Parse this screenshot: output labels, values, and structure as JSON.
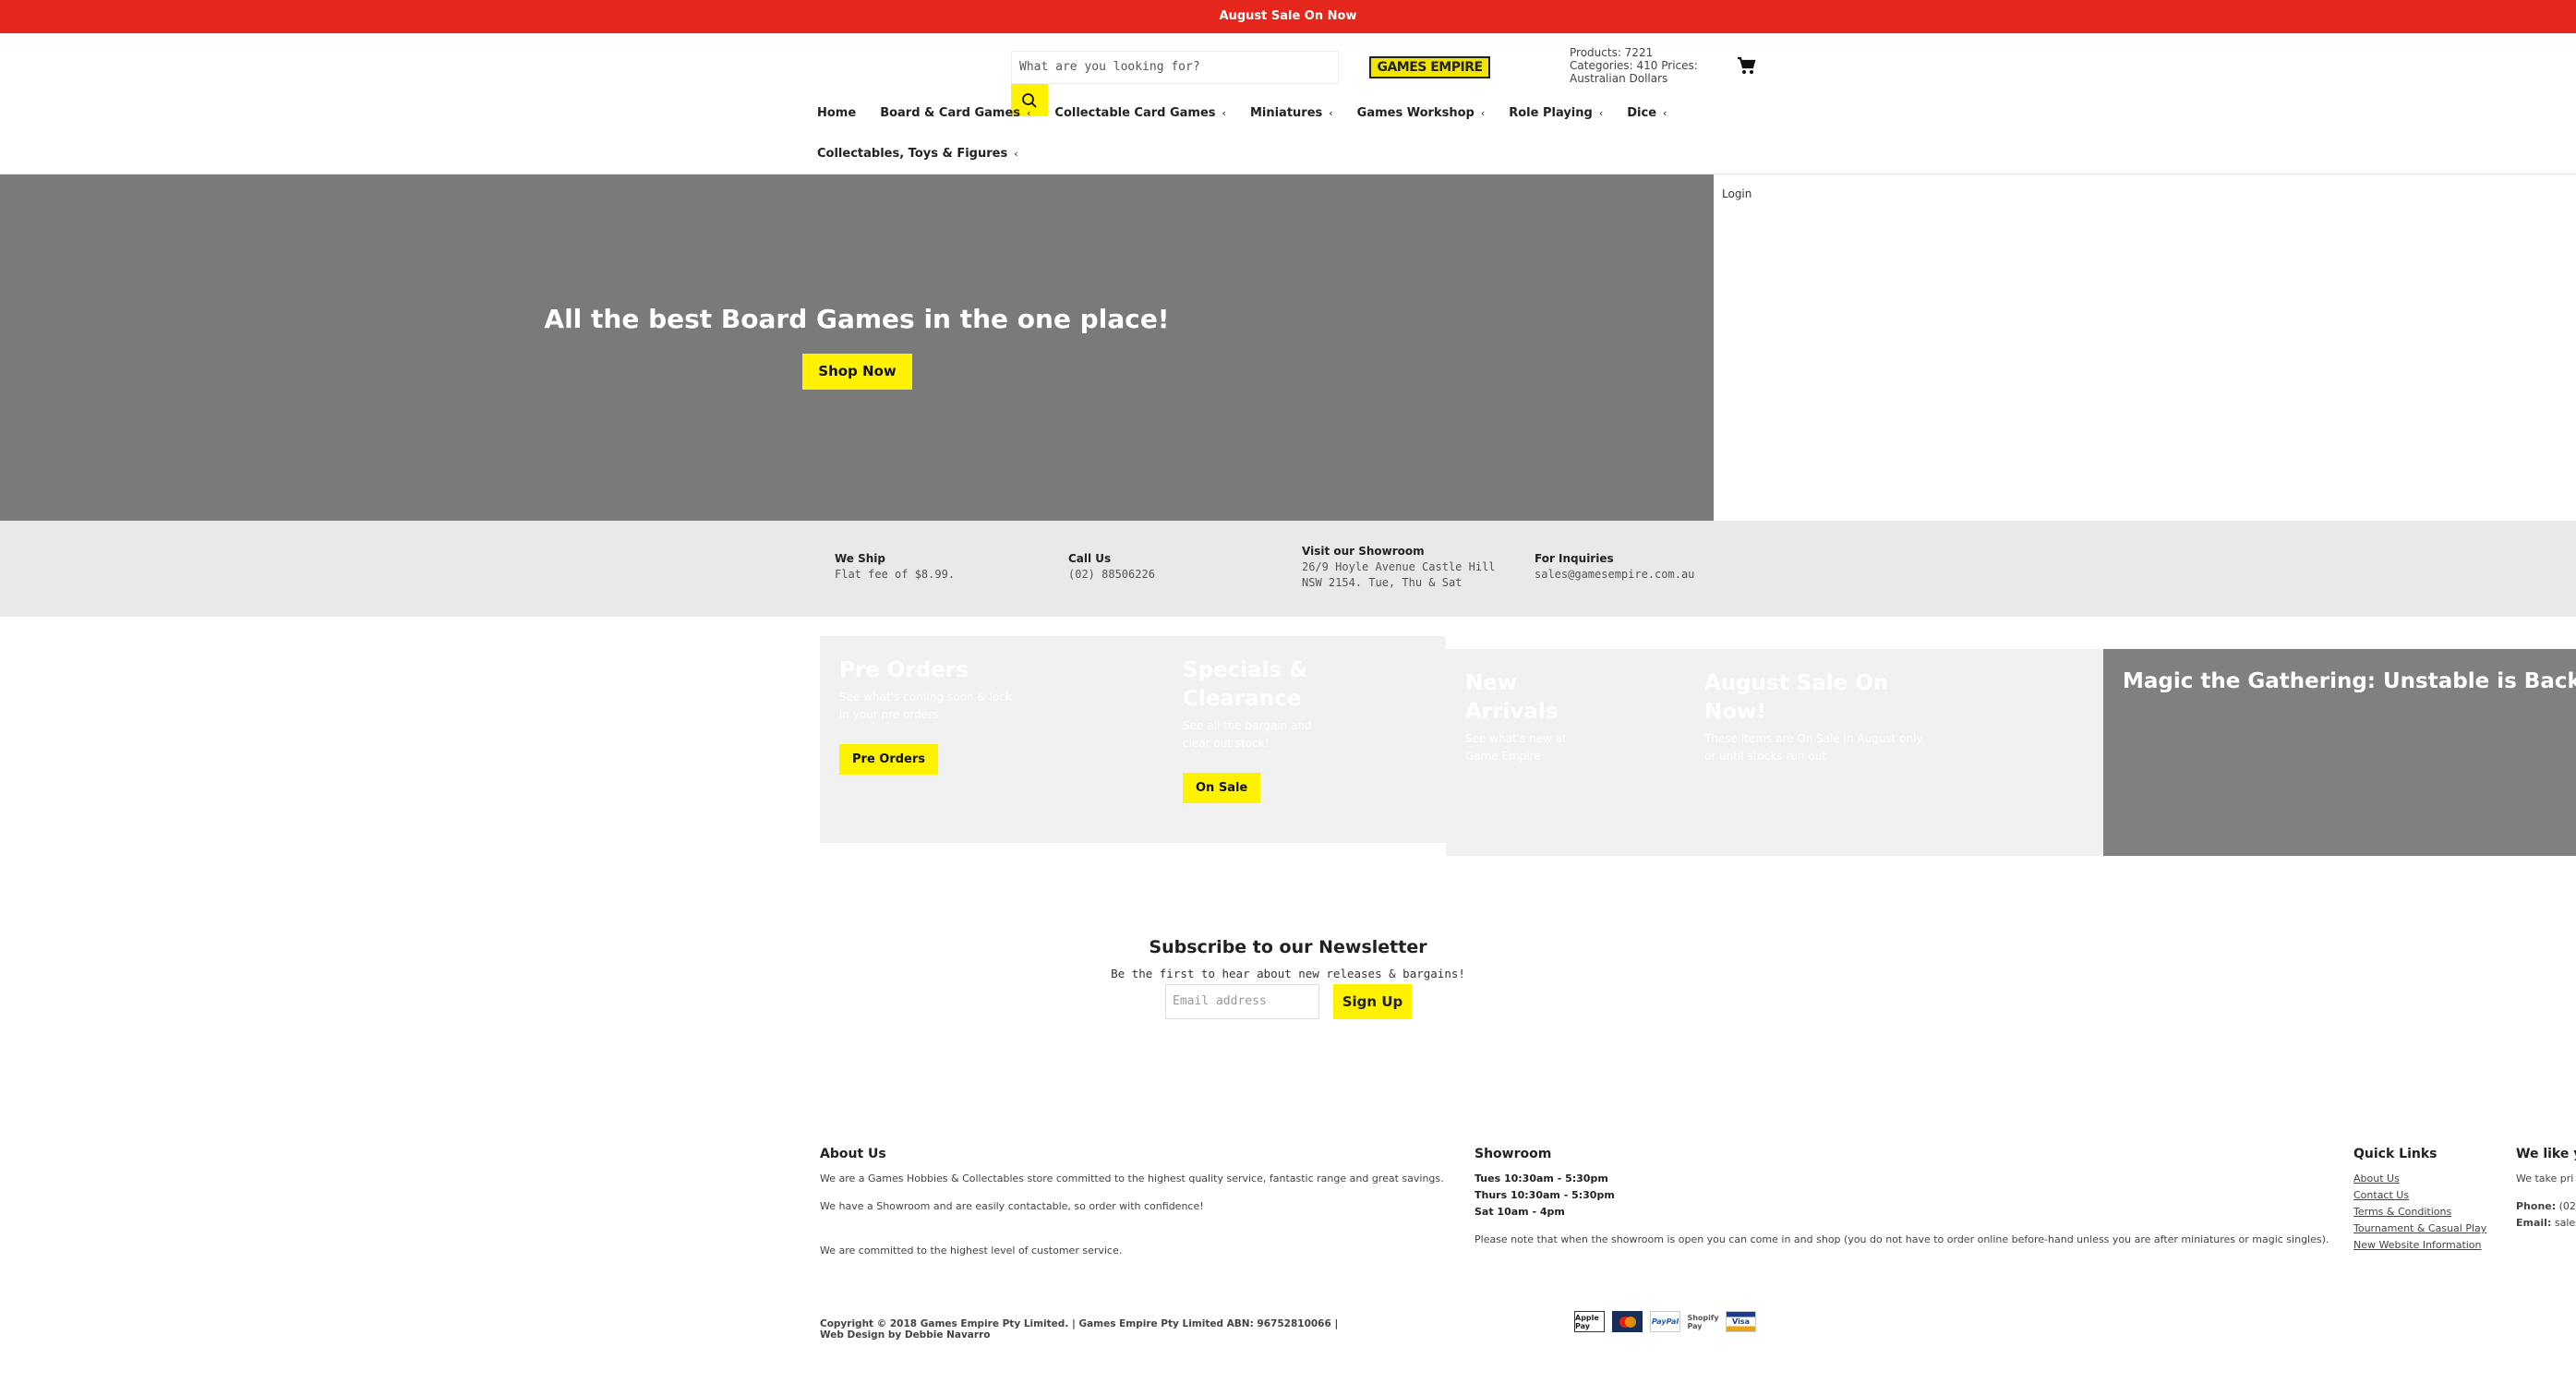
{
  "announcement": "August Sale On Now",
  "search": {
    "placeholder": "What are you looking for?"
  },
  "logo": {
    "text": "GAMES EMPIRE"
  },
  "stats": {
    "text": "Products: 7221 Categories: 410 Prices: Australian Dollars"
  },
  "nav": {
    "items": [
      {
        "label": "Home"
      },
      {
        "label": "Board & Card Games"
      },
      {
        "label": "Collectable Card Games"
      },
      {
        "label": "Miniatures"
      },
      {
        "label": "Games Workshop"
      },
      {
        "label": "Role Playing"
      },
      {
        "label": "Dice"
      },
      {
        "label": "Collectables, Toys & Figures"
      }
    ],
    "chevron": "‹"
  },
  "hero": {
    "title": "All the best Board Games in the one place!",
    "button": "Shop Now"
  },
  "login": "Login",
  "info": [
    {
      "title": "We Ship",
      "text": "Flat fee of $8.99."
    },
    {
      "title": "Call Us",
      "text": "(02) 88506226"
    },
    {
      "title": "Visit our Showroom",
      "text": "26/9 Hoyle Avenue Castle Hill NSW 2154. Tue, Thu & Sat"
    },
    {
      "title": "For Inquiries",
      "text": "sales@gamesempire.com.au"
    }
  ],
  "promos": [
    {
      "title": "Pre Orders",
      "text": "See what's coming soon & lock in your pre orders",
      "button": "Pre Orders"
    },
    {
      "title": "Specials & Clearance",
      "text": "See all the bargain and clear out stock!",
      "button": "On Sale"
    },
    {
      "title": "New Arrivals",
      "text": "See what's new at Game Empire"
    },
    {
      "title": "August Sale On Now!",
      "text": "These items are On Sale in August only or until stocks run out"
    },
    {
      "title": "Magic the Gathering: Unstable is Back!"
    }
  ],
  "newsletter": {
    "title": "Subscribe to our Newsletter",
    "subtitle": "Be the first to hear about new releases & bargains!",
    "placeholder": "Email address",
    "button": "Sign Up"
  },
  "footer": {
    "about": {
      "title": "About Us",
      "p1": "We are a Games Hobbies & Collectables store committed to the highest quality service, fantastic range and great savings.",
      "p2": "We have a Showroom and are easily contactable, so order with confidence!",
      "p3": "We are committed to the highest level of customer service."
    },
    "showroom": {
      "title": "Showroom",
      "hours": [
        "Tues 10:30am - 5:30pm",
        "Thurs 10:30am - 5:30pm",
        "Sat 10am - 4pm"
      ],
      "note": "Please note that when the showroom is open you can come in and shop (you do not have to order online before-hand unless you are after miniatures or magic singles)."
    },
    "quick_links": {
      "title": "Quick Links",
      "items": [
        "About Us",
        "Contact Us",
        "Terms & Conditions",
        "Tournament & Casual Play",
        "New Website Information"
      ]
    },
    "contact": {
      "title": "We like y",
      "text": "We take pri",
      "phone_label": "Phone:",
      "phone": "(02",
      "email_label": "Email:",
      "email": "sales"
    },
    "copyright": "Copyright © 2018 Games Empire Pty Limited. | Games Empire Pty Limited ABN: 96752810066 | Web Design by Debbie Navarro",
    "payments": [
      "Apple Pay",
      "Mastercard",
      "PayPal",
      "Shopify Pay",
      "Visa"
    ]
  },
  "colors": {
    "announcement": "#e4261c",
    "accent": "#fff200",
    "hero": "#7a7a7a"
  }
}
